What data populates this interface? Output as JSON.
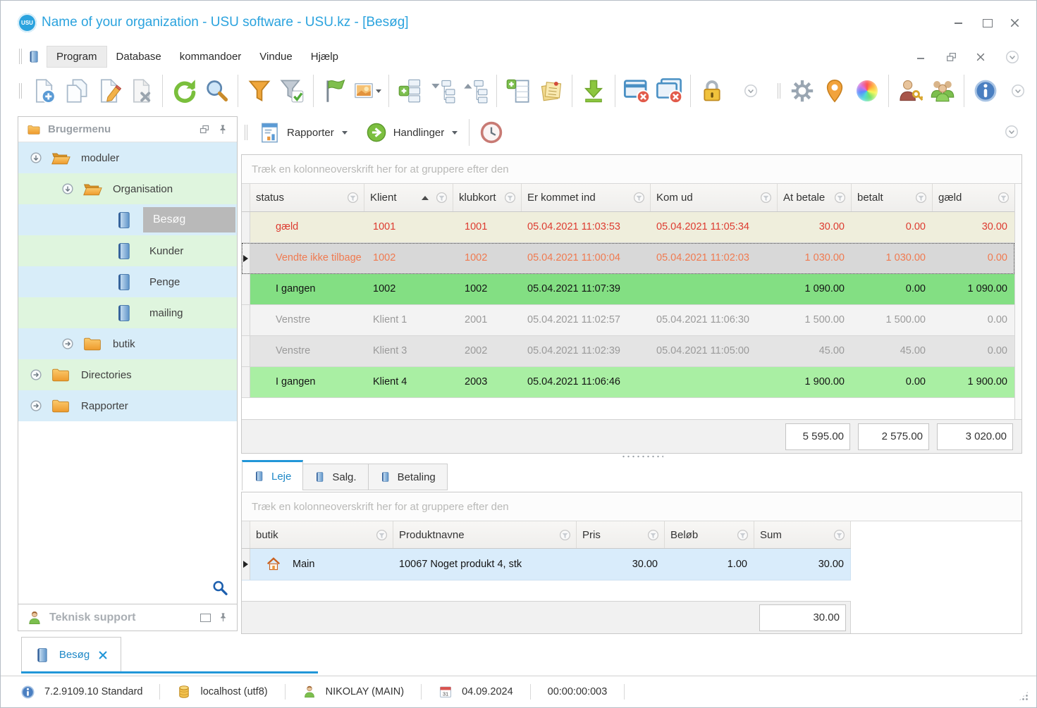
{
  "window": {
    "title": "Name of your organization - USU software - USU.kz - [Besøg]",
    "logo": "USU"
  },
  "menu": {
    "items": [
      "Program",
      "Database",
      "kommandoer",
      "Vindue",
      "Hjælp"
    ]
  },
  "toolbar": {
    "icons": [
      "new-document",
      "copy-document",
      "edit-document",
      "delete-document",
      "refresh",
      "search",
      "filter",
      "filter-accept",
      "flag",
      "image",
      "add-group",
      "collapse-tree",
      "expand-tree",
      "add-column",
      "notes",
      "download",
      "close-window",
      "close-all-windows",
      "lock",
      "overflow",
      "settings-gear",
      "location-pin",
      "color-wheel",
      "user-permissions",
      "users-group",
      "info",
      "overflow"
    ]
  },
  "report_bar": {
    "rapporter_label": "Rapporter",
    "handlinger_label": "Handlinger"
  },
  "sidebar": {
    "title": "Brugermenu",
    "support_label": "Teknisk support",
    "tree": [
      {
        "label": "moduler"
      },
      {
        "label": "Organisation"
      },
      {
        "label": "Besøg"
      },
      {
        "label": "Kunder"
      },
      {
        "label": "Penge"
      },
      {
        "label": "mailing"
      },
      {
        "label": "butik"
      },
      {
        "label": "Directories"
      },
      {
        "label": "Rapporter"
      }
    ]
  },
  "grid": {
    "group_hint": "Træk en kolonneoverskrift her for at gruppere efter den",
    "columns": [
      "status",
      "Klient",
      "klubkort",
      "Er kommet ind",
      "Kom ud",
      "At betale",
      "betalt",
      "gæld"
    ],
    "rows": [
      {
        "cells": [
          "gæld",
          "1001",
          "1001",
          "05.04.2021 11:03:53",
          "05.04.2021 11:05:34",
          "30.00",
          "0.00",
          "30.00"
        ]
      },
      {
        "cells": [
          "Vendte ikke tilbage",
          "1002",
          "1002",
          "05.04.2021 11:00:04",
          "05.04.2021 11:02:03",
          "1 030.00",
          "1 030.00",
          "0.00"
        ]
      },
      {
        "cells": [
          "I gangen",
          "1002",
          "1002",
          "05.04.2021 11:07:39",
          "",
          "1 090.00",
          "0.00",
          "1 090.00"
        ]
      },
      {
        "cells": [
          "Venstre",
          "Klient 1",
          "2001",
          "05.04.2021 11:02:57",
          "05.04.2021 11:06:30",
          "1 500.00",
          "1 500.00",
          "0.00"
        ]
      },
      {
        "cells": [
          "Venstre",
          "Klient 3",
          "2002",
          "05.04.2021 11:02:39",
          "05.04.2021 11:05:00",
          "45.00",
          "45.00",
          "0.00"
        ]
      },
      {
        "cells": [
          "I gangen",
          "Klient 4",
          "2003",
          "05.04.2021 11:06:46",
          "",
          "1 900.00",
          "0.00",
          "1 900.00"
        ]
      }
    ],
    "totals": {
      "at_betale": "5 595.00",
      "betalt": "2 575.00",
      "gaeld": "3 020.00"
    }
  },
  "detail": {
    "tabs": [
      "Leje",
      "Salg.",
      "Betaling"
    ],
    "active_tab": "Leje",
    "group_hint": "Træk en kolonneoverskrift her for at gruppere efter den",
    "columns": [
      "butik",
      "Produktnavne",
      "Pris",
      "Beløb",
      "Sum"
    ],
    "rows": [
      {
        "butik": "Main",
        "produkt": "10067 Noget produkt 4, stk",
        "pris": "30.00",
        "belob": "1.00",
        "sum": "30.00"
      }
    ],
    "total": "30.00"
  },
  "doc_tab": {
    "label": "Besøg"
  },
  "statusbar": {
    "version": "7.2.9109.10 Standard",
    "database": "localhost (utf8)",
    "user": "NIKOLAY (MAIN)",
    "calendar_day": "31",
    "date": "04.09.2024",
    "timer": "00:00:00:003"
  },
  "colors": {
    "accent_blue": "#2196d8",
    "title_blue": "#2ba3de",
    "row_green": "#83df83",
    "row_yellow": "#efeedc",
    "row_debt_text": "#dd3b30",
    "row_noreturn_text": "#f07a50",
    "selection_blue": "#d9ecfb"
  }
}
